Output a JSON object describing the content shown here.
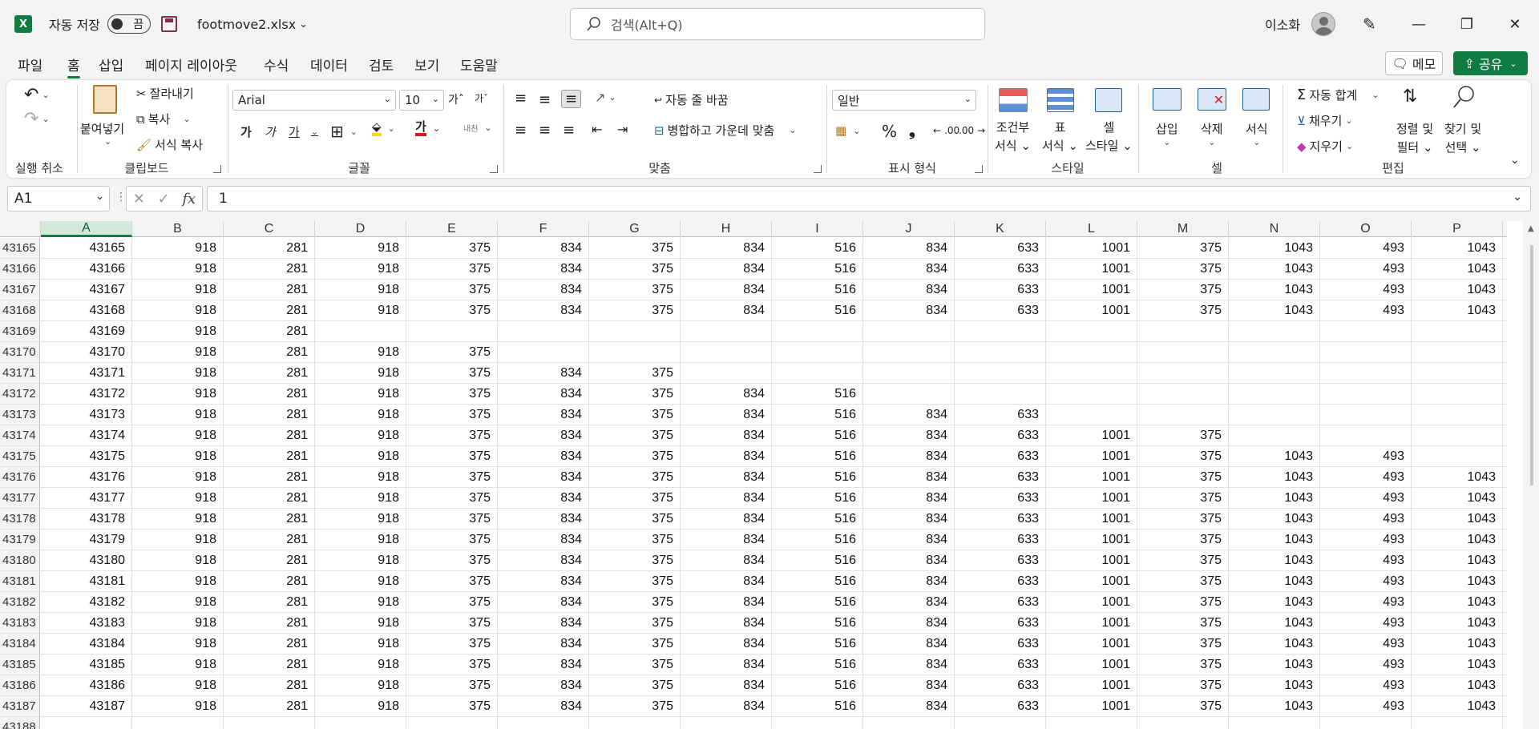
{
  "titlebar": {
    "logo": "X",
    "autosave_label": "자동 저장",
    "autosave_state": "끔",
    "filename": "footmove2.xlsx",
    "search_placeholder": "검색(Alt+Q)",
    "user_name": "이소화"
  },
  "menu": {
    "tabs": [
      "파일",
      "홈",
      "삽입",
      "페이지 레이아웃",
      "수식",
      "데이터",
      "검토",
      "보기",
      "도움말"
    ],
    "active": "홈",
    "memo": "메모",
    "share": "공유"
  },
  "ribbon": {
    "undo_label": "실행 취소",
    "clipboard": {
      "paste": "붙여넣기",
      "cut": "잘라내기",
      "copy": "복사",
      "format_painter": "서식 복사",
      "label": "클립보드"
    },
    "font": {
      "name": "Arial",
      "size": "10",
      "bold": "가",
      "italic": "가",
      "underline": "가",
      "font_color": "가",
      "phonetic": "내천",
      "label": "글꼴"
    },
    "align": {
      "wrap": "자동 줄 바꿈",
      "merge": "병합하고 가운데 맞춤",
      "label": "맞춤"
    },
    "number": {
      "format": "일반",
      "percent": "%",
      "comma": "❟",
      "inc": ".00",
      "dec": ".00",
      "label": "표시 형식"
    },
    "styles": {
      "cond1": "조건부",
      "cond2": "서식",
      "table1": "표",
      "table2": "서식",
      "cell1": "셀",
      "cell2": "스타일",
      "label": "스타일"
    },
    "cells": {
      "insert": "삽입",
      "delete": "삭제",
      "format": "서식",
      "label": "셀"
    },
    "editing": {
      "autosum": "자동 합계",
      "fill": "채우기",
      "clear": "지우기",
      "sort1": "정렬 및",
      "sort2": "필터",
      "find1": "찾기 및",
      "find2": "선택",
      "label": "편집"
    },
    "colors": {
      "accent": "#107c41",
      "font_red": "#e81123",
      "highlight": "#ffd800"
    }
  },
  "formula_bar": {
    "name_box": "A1",
    "fx": "fx",
    "value": "1"
  },
  "sheet": {
    "columns": [
      "A",
      "B",
      "C",
      "D",
      "E",
      "F",
      "G",
      "H",
      "I",
      "J",
      "K",
      "L",
      "M",
      "N",
      "O",
      "P"
    ],
    "selected_column": "A",
    "rows": [
      {
        "n": "43165",
        "cells": [
          "43165",
          "918",
          "281",
          "918",
          "375",
          "834",
          "375",
          "834",
          "516",
          "834",
          "633",
          "1001",
          "375",
          "1043",
          "493",
          "1043"
        ]
      },
      {
        "n": "43166",
        "cells": [
          "43166",
          "918",
          "281",
          "918",
          "375",
          "834",
          "375",
          "834",
          "516",
          "834",
          "633",
          "1001",
          "375",
          "1043",
          "493",
          "1043"
        ]
      },
      {
        "n": "43167",
        "cells": [
          "43167",
          "918",
          "281",
          "918",
          "375",
          "834",
          "375",
          "834",
          "516",
          "834",
          "633",
          "1001",
          "375",
          "1043",
          "493",
          "1043"
        ]
      },
      {
        "n": "43168",
        "cells": [
          "43168",
          "918",
          "281",
          "918",
          "375",
          "834",
          "375",
          "834",
          "516",
          "834",
          "633",
          "1001",
          "375",
          "1043",
          "493",
          "1043"
        ]
      },
      {
        "n": "43169",
        "cells": [
          "43169",
          "918",
          "281",
          "",
          "",
          "",
          "",
          "",
          "",
          "",
          "",
          "",
          "",
          "",
          "",
          ""
        ]
      },
      {
        "n": "43170",
        "cells": [
          "43170",
          "918",
          "281",
          "918",
          "375",
          "",
          "",
          "",
          "",
          "",
          "",
          "",
          "",
          "",
          "",
          ""
        ]
      },
      {
        "n": "43171",
        "cells": [
          "43171",
          "918",
          "281",
          "918",
          "375",
          "834",
          "375",
          "",
          "",
          "",
          "",
          "",
          "",
          "",
          "",
          ""
        ]
      },
      {
        "n": "43172",
        "cells": [
          "43172",
          "918",
          "281",
          "918",
          "375",
          "834",
          "375",
          "834",
          "516",
          "",
          "",
          "",
          "",
          "",
          "",
          ""
        ]
      },
      {
        "n": "43173",
        "cells": [
          "43173",
          "918",
          "281",
          "918",
          "375",
          "834",
          "375",
          "834",
          "516",
          "834",
          "633",
          "",
          "",
          "",
          "",
          ""
        ]
      },
      {
        "n": "43174",
        "cells": [
          "43174",
          "918",
          "281",
          "918",
          "375",
          "834",
          "375",
          "834",
          "516",
          "834",
          "633",
          "1001",
          "375",
          "",
          "",
          ""
        ]
      },
      {
        "n": "43175",
        "cells": [
          "43175",
          "918",
          "281",
          "918",
          "375",
          "834",
          "375",
          "834",
          "516",
          "834",
          "633",
          "1001",
          "375",
          "1043",
          "493",
          ""
        ]
      },
      {
        "n": "43176",
        "cells": [
          "43176",
          "918",
          "281",
          "918",
          "375",
          "834",
          "375",
          "834",
          "516",
          "834",
          "633",
          "1001",
          "375",
          "1043",
          "493",
          "1043"
        ]
      },
      {
        "n": "43177",
        "cells": [
          "43177",
          "918",
          "281",
          "918",
          "375",
          "834",
          "375",
          "834",
          "516",
          "834",
          "633",
          "1001",
          "375",
          "1043",
          "493",
          "1043"
        ]
      },
      {
        "n": "43178",
        "cells": [
          "43178",
          "918",
          "281",
          "918",
          "375",
          "834",
          "375",
          "834",
          "516",
          "834",
          "633",
          "1001",
          "375",
          "1043",
          "493",
          "1043"
        ]
      },
      {
        "n": "43179",
        "cells": [
          "43179",
          "918",
          "281",
          "918",
          "375",
          "834",
          "375",
          "834",
          "516",
          "834",
          "633",
          "1001",
          "375",
          "1043",
          "493",
          "1043"
        ]
      },
      {
        "n": "43180",
        "cells": [
          "43180",
          "918",
          "281",
          "918",
          "375",
          "834",
          "375",
          "834",
          "516",
          "834",
          "633",
          "1001",
          "375",
          "1043",
          "493",
          "1043"
        ]
      },
      {
        "n": "43181",
        "cells": [
          "43181",
          "918",
          "281",
          "918",
          "375",
          "834",
          "375",
          "834",
          "516",
          "834",
          "633",
          "1001",
          "375",
          "1043",
          "493",
          "1043"
        ]
      },
      {
        "n": "43182",
        "cells": [
          "43182",
          "918",
          "281",
          "918",
          "375",
          "834",
          "375",
          "834",
          "516",
          "834",
          "633",
          "1001",
          "375",
          "1043",
          "493",
          "1043"
        ]
      },
      {
        "n": "43183",
        "cells": [
          "43183",
          "918",
          "281",
          "918",
          "375",
          "834",
          "375",
          "834",
          "516",
          "834",
          "633",
          "1001",
          "375",
          "1043",
          "493",
          "1043"
        ]
      },
      {
        "n": "43184",
        "cells": [
          "43184",
          "918",
          "281",
          "918",
          "375",
          "834",
          "375",
          "834",
          "516",
          "834",
          "633",
          "1001",
          "375",
          "1043",
          "493",
          "1043"
        ]
      },
      {
        "n": "43185",
        "cells": [
          "43185",
          "918",
          "281",
          "918",
          "375",
          "834",
          "375",
          "834",
          "516",
          "834",
          "633",
          "1001",
          "375",
          "1043",
          "493",
          "1043"
        ]
      },
      {
        "n": "43186",
        "cells": [
          "43186",
          "918",
          "281",
          "918",
          "375",
          "834",
          "375",
          "834",
          "516",
          "834",
          "633",
          "1001",
          "375",
          "1043",
          "493",
          "1043"
        ]
      },
      {
        "n": "43187",
        "cells": [
          "43187",
          "918",
          "281",
          "918",
          "375",
          "834",
          "375",
          "834",
          "516",
          "834",
          "633",
          "1001",
          "375",
          "1043",
          "493",
          "1043"
        ]
      },
      {
        "n": "43188",
        "cells": [
          "",
          "",
          "",
          "",
          "",
          "",
          "",
          "",
          "",
          "",
          "",
          "",
          "",
          "",
          "",
          ""
        ]
      }
    ]
  }
}
